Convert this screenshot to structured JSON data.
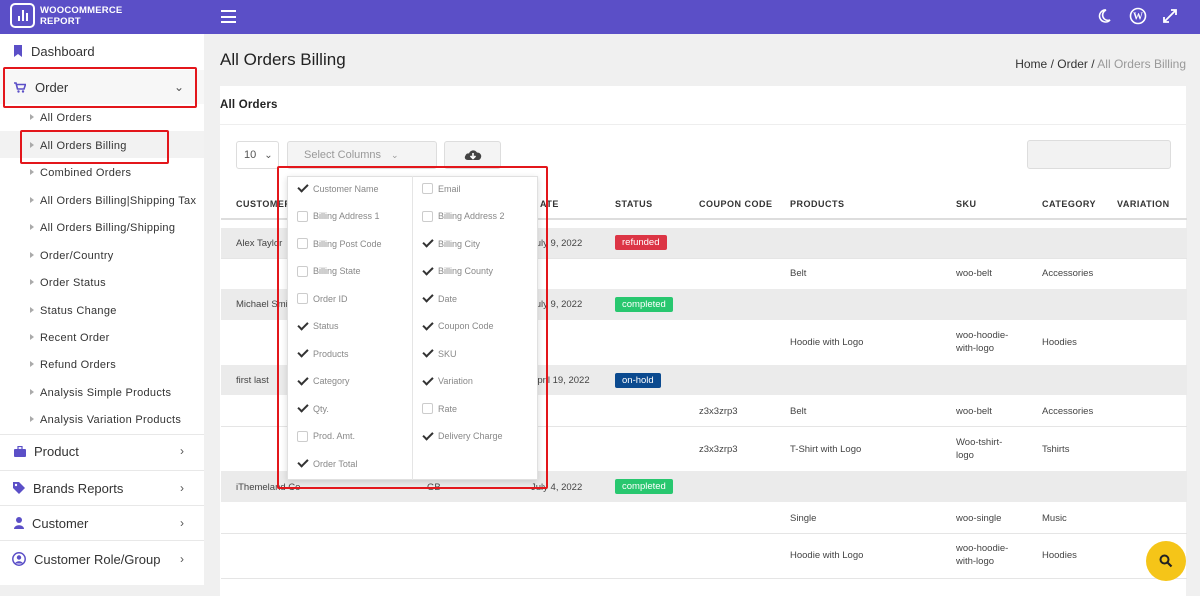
{
  "app": {
    "logo_line1": "WOOCOMMERCE",
    "logo_line2": "REPORT"
  },
  "colors": {
    "topbar": "#5b4fc7",
    "refunded": "#dc3545",
    "completed": "#28c76f",
    "onhold": "#0b4a8f",
    "fab": "#f5c518"
  },
  "topbar_icons": [
    "hamburger-icon",
    "moon-icon",
    "wordpress-icon",
    "fullscreen-icon"
  ],
  "sidebar": {
    "dashboard": "Dashboard",
    "order": "Order",
    "order_sub": [
      "All Orders",
      "All Orders Billing",
      "Combined Orders",
      "All Orders Billing|Shipping Tax",
      "All Orders Billing/Shipping",
      "Order/Country",
      "Order Status",
      "Status Change",
      "Recent Order",
      "Refund Orders",
      "Analysis Simple Products",
      "Analysis Variation Products"
    ],
    "product": "Product",
    "brands": "Brands Reports",
    "customer": "Customer",
    "customer_role": "Customer Role/Group"
  },
  "page": {
    "title": "All Orders Billing",
    "crumb_home": "Home",
    "crumb_sep": "/",
    "crumb_order": "Order",
    "crumb_current": "All Orders Billing"
  },
  "card": {
    "title": "All Orders"
  },
  "toolbar": {
    "page_size": "10",
    "select_columns": "Select Columns",
    "search_value": ""
  },
  "table": {
    "headers": [
      "CUSTOMER",
      "ATE",
      "STATUS",
      "COUPON CODE",
      "PRODUCTS",
      "SKU",
      "CATEGORY",
      "VARIATION"
    ],
    "rows": [
      {
        "customer": "Alex Taylor",
        "date": "July 9, 2022",
        "status": "refunded",
        "coupon": "",
        "product": "",
        "sku": "",
        "category": ""
      },
      {
        "customer": "",
        "date": "",
        "status": "",
        "coupon": "",
        "product": "Belt",
        "sku": "woo-belt",
        "category": "Accessories"
      },
      {
        "customer": "Michael Smi",
        "date": "July 9, 2022",
        "status": "completed",
        "coupon": "",
        "product": "",
        "sku": "",
        "category": ""
      },
      {
        "customer": "",
        "date": "",
        "status": "",
        "coupon": "",
        "product": "Hoodie with Logo",
        "sku": "woo-hoodie-with-logo",
        "category": "Hoodies"
      },
      {
        "customer": "first last",
        "date": "April 19, 2022",
        "status": "on-hold",
        "coupon": "",
        "product": "",
        "sku": "",
        "category": ""
      },
      {
        "customer": "",
        "date": "",
        "status": "",
        "coupon": "z3x3zrp3",
        "product": "Belt",
        "sku": "woo-belt",
        "category": "Accessories"
      },
      {
        "customer": "",
        "date": "",
        "status": "",
        "coupon": "z3x3zrp3",
        "product": "T-Shirt with Logo",
        "sku": "Woo-tshirt-logo",
        "category": "Tshirts"
      },
      {
        "customer": "iThemeland Co",
        "country": "GB",
        "date": "July 4, 2022",
        "status": "completed",
        "coupon": "",
        "product": "",
        "sku": "",
        "category": ""
      },
      {
        "customer": "",
        "date": "",
        "status": "",
        "coupon": "",
        "product": "Single",
        "sku": "woo-single",
        "category": "Music"
      },
      {
        "customer": "",
        "date": "",
        "status": "",
        "coupon": "",
        "product": "Hoodie with Logo",
        "sku": "woo-hoodie-with-logo",
        "category": "Hoodies"
      }
    ]
  },
  "columns_dropdown": {
    "left": [
      {
        "label": "Customer Name",
        "checked": true
      },
      {
        "label": "Billing Address 1",
        "checked": false
      },
      {
        "label": "Billing Post Code",
        "checked": false
      },
      {
        "label": "Billing State",
        "checked": false
      },
      {
        "label": "Order ID",
        "checked": false
      },
      {
        "label": "Status",
        "checked": true
      },
      {
        "label": "Products",
        "checked": true
      },
      {
        "label": "Category",
        "checked": true
      },
      {
        "label": "Qty.",
        "checked": true
      },
      {
        "label": "Prod. Amt.",
        "checked": false
      },
      {
        "label": "Order Total",
        "checked": true
      }
    ],
    "right": [
      {
        "label": "Email",
        "checked": false
      },
      {
        "label": "Billing Address 2",
        "checked": false
      },
      {
        "label": "Billing City",
        "checked": true
      },
      {
        "label": "Billing County",
        "checked": true
      },
      {
        "label": "Date",
        "checked": true
      },
      {
        "label": "Coupon Code",
        "checked": true
      },
      {
        "label": "SKU",
        "checked": true
      },
      {
        "label": "Variation",
        "checked": true
      },
      {
        "label": "Rate",
        "checked": false
      },
      {
        "label": "Delivery Charge",
        "checked": true
      }
    ]
  }
}
